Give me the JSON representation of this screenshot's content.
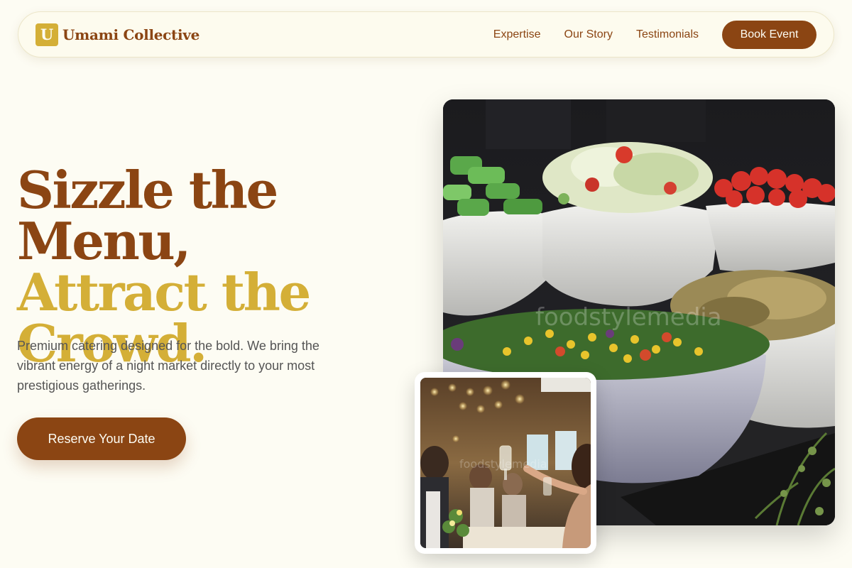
{
  "nav": {
    "logo_letter": "U",
    "brand_name": "Umami Collective",
    "links": [
      "Expertise",
      "Our Story",
      "Testimonials"
    ],
    "cta": "Book Event"
  },
  "hero": {
    "title_line1": "Sizzle the Menu,",
    "title_line2a": "Attract the",
    "title_line2b": "Crowd.",
    "description": "Premium catering designed for the bold. We bring the vibrant energy of a night market directly to your most prestigious gatherings.",
    "cta": "Reserve Your Date"
  },
  "images": {
    "main_watermark": "foodstylemedia",
    "inset_watermark": "foodstylemedia"
  },
  "colors": {
    "background": "#fdfcf3",
    "primary": "#8b4513",
    "accent": "#d4af37"
  }
}
